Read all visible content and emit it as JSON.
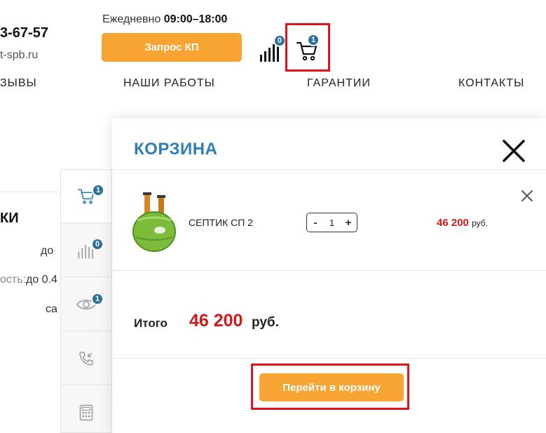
{
  "header": {
    "phone": "3-67-57",
    "site": "t-spb.ru",
    "hours_label": "Ежедневно",
    "hours_value": "09:00–18:00",
    "request_button": "Запрос КП",
    "compare_count": "0",
    "cart_count": "1"
  },
  "nav": {
    "item_reviews": "ЗЫВЫ",
    "item_works": "НАШИ РАБОТЫ",
    "item_guarantees": "ГАРАНТИИ",
    "item_contacts": "КОНТАКТЫ"
  },
  "background": {
    "heading_fragment": "КИ",
    "row1": "до",
    "row2_label": "ость:",
    "row2_value": "до 0.4",
    "row3": "са"
  },
  "sidebar": {
    "cart_count": "1",
    "compare_count": "0",
    "viewed_count": "1"
  },
  "cart": {
    "title": "КОРЗИНА",
    "item": {
      "name": "СЕПТИК СП 2",
      "qty": "1",
      "qty_minus": "-",
      "qty_plus": "+",
      "price": "46 200",
      "price_currency": "руб."
    },
    "total_label": "Итого",
    "total_value": "46 200",
    "total_currency": "руб.",
    "goto_button": "Перейти в корзину"
  },
  "colors": {
    "accent_orange": "#f7a433",
    "title_blue": "#2f7fb5",
    "price_red": "#d21a1a",
    "highlight_red": "#e0131b",
    "badge_blue": "#2f6f9c"
  }
}
